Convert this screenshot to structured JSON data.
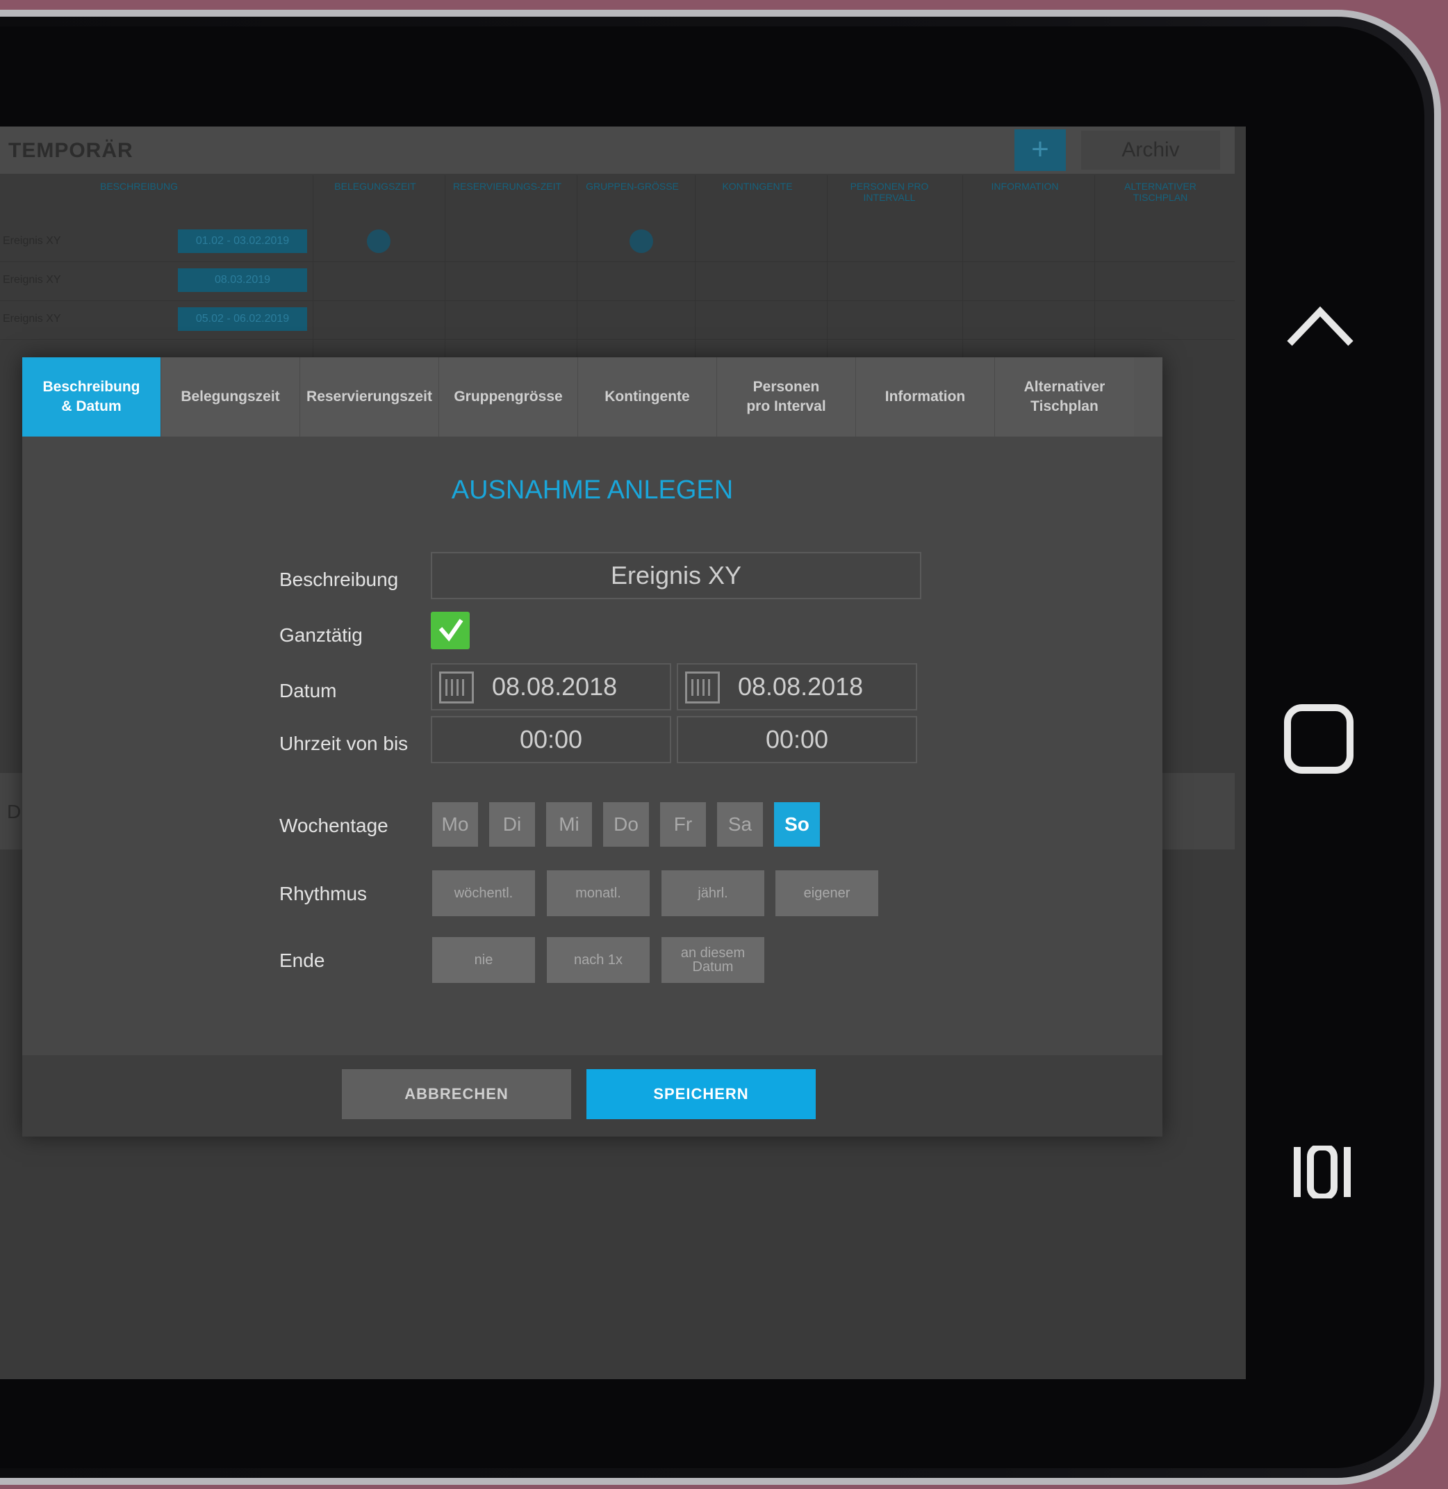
{
  "background_app": {
    "title": "TEMPORÄR",
    "add_label": "+",
    "archive_label": "Archiv",
    "columns": [
      "BESCHREIBUNG",
      "BELEGUNGSZEIT",
      "RESERVIERUNGS-ZEIT",
      "GRUPPEN-GRÖSSE",
      "KONTINGENTE",
      "PERSONEN PRO INTERVALL",
      "INFORMATION",
      "ALTERNATIVER TISCHPLAN"
    ],
    "rows": [
      {
        "label": "Ereignis XY",
        "date": "01.02 - 03.02.2019"
      },
      {
        "label": "Ereignis XY",
        "date": "08.03.2019"
      },
      {
        "label": "Ereignis XY",
        "date": "05.02 - 06.02.2019"
      }
    ],
    "lower_label": "D"
  },
  "modal": {
    "tabs": [
      {
        "label": "Beschreibung\n& Datum",
        "active": true
      },
      {
        "label": "Belegungszeit"
      },
      {
        "label": "Reservierungszeit"
      },
      {
        "label": "Gruppengrösse"
      },
      {
        "label": "Kontingente"
      },
      {
        "label": "Personen\npro Interval"
      },
      {
        "label": "Information"
      },
      {
        "label": "Alternativer\nTischplan"
      }
    ],
    "title": "AUSNAHME ANLEGEN",
    "fields": {
      "beschreibung_label": "Beschreibung",
      "beschreibung_value": "Ereignis XY",
      "ganztaegig_label": "Ganztätig",
      "ganztaegig_checked": true,
      "datum_label": "Datum",
      "datum_from": "08.08.2018",
      "datum_to": "08.08.2018",
      "uhrzeit_label": "Uhrzeit von bis",
      "uhrzeit_from": "00:00",
      "uhrzeit_to": "00:00",
      "wochentage_label": "Wochentage",
      "days": [
        "Mo",
        "Di",
        "Mi",
        "Do",
        "Fr",
        "Sa",
        "So"
      ],
      "active_day": "So",
      "rhythmus_label": "Rhythmus",
      "rhythmus_options": [
        "wöchentl.",
        "monatl.",
        "jährl.",
        "eigener"
      ],
      "ende_label": "Ende",
      "ende_options": [
        "nie",
        "nach 1x",
        "an diesem\nDatum"
      ]
    },
    "buttons": {
      "cancel": "ABBRECHEN",
      "save": "SPEICHERN"
    }
  },
  "colors": {
    "accent": "#1aa6da",
    "check": "#4ec13e",
    "modal_bg": "#474747"
  },
  "device_nav": {
    "icons": [
      "chevron-up-icon",
      "home-square-icon",
      "recent-apps-icon"
    ]
  }
}
